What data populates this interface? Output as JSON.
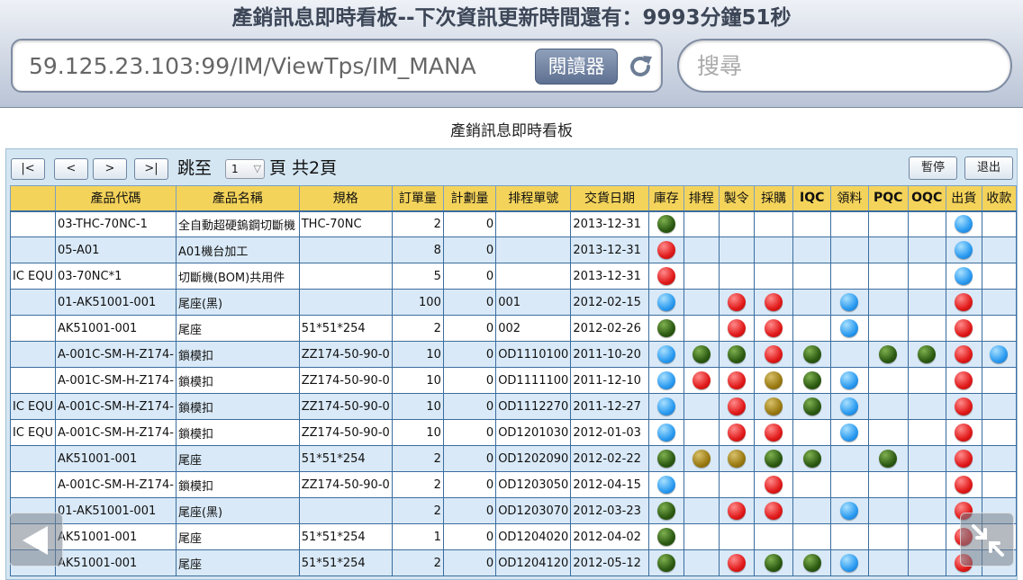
{
  "browser": {
    "title": "產銷訊息即時看板--下次資訊更新時間還有：9993分鐘51秒",
    "url": "59.125.23.103:99/IM/ViewTps/IM_MANA",
    "reader_label": "閱讀器",
    "search_placeholder": "搜尋"
  },
  "page": {
    "title": "產銷訊息即時看板",
    "nav": {
      "first": "|<",
      "prev": "<",
      "next": ">",
      "last": ">|"
    },
    "jump_label": "跳至",
    "page_value": "1",
    "page_total": "頁 共2頁",
    "pause_label": "暫停",
    "exit_label": "退出"
  },
  "table": {
    "columns": [
      "",
      "產品代碼",
      "產品名稱",
      "規格",
      "訂單量",
      "計劃量",
      "排程單號",
      "交貨日期",
      "庫存",
      "排程",
      "製令",
      "採購",
      "IQC",
      "領料",
      "PQC",
      "OQC",
      "出貨",
      "收款"
    ],
    "status_legend": {
      "G": "#2c5a12",
      "R": "#e11a1a",
      "B": "#2b9bf0",
      "Y": "#9a7a12"
    },
    "rows": [
      {
        "c0": "",
        "code": "03-THC-70NC-1",
        "name": "全自動超硬鎢鋼切斷機",
        "spec": "THC-70NC",
        "order": "2",
        "plan": "0",
        "sched": "",
        "date": "2013-12-31",
        "status": [
          "G",
          "",
          "",
          "",
          "",
          "",
          "",
          "",
          "B",
          ""
        ]
      },
      {
        "c0": "",
        "code": "05-A01",
        "name": "A01機台加工",
        "spec": "",
        "order": "8",
        "plan": "0",
        "sched": "",
        "date": "2013-12-31",
        "status": [
          "R",
          "",
          "",
          "",
          "",
          "",
          "",
          "",
          "B",
          ""
        ]
      },
      {
        "c0": "IC EQU",
        "code": "03-70NC*1",
        "name": "切斷機(BOM)共用件",
        "spec": "",
        "order": "5",
        "plan": "0",
        "sched": "",
        "date": "2013-12-31",
        "status": [
          "R",
          "",
          "",
          "",
          "",
          "",
          "",
          "",
          "B",
          ""
        ]
      },
      {
        "c0": "",
        "code": "01-AK51001-001",
        "name": "尾座(黑)",
        "spec": "",
        "order": "100",
        "plan": "0",
        "sched": "001",
        "date": "2012-02-15",
        "status": [
          "B",
          "",
          "R",
          "R",
          "",
          "B",
          "",
          "",
          "R",
          ""
        ]
      },
      {
        "c0": "",
        "code": "AK51001-001",
        "name": "尾座",
        "spec": "51*51*254",
        "order": "2",
        "plan": "0",
        "sched": "002",
        "date": "2012-02-26",
        "status": [
          "G",
          "",
          "R",
          "R",
          "",
          "B",
          "",
          "",
          "R",
          ""
        ]
      },
      {
        "c0": "",
        "code": "A-001C-SM-H-Z174-",
        "name": "鎖模扣",
        "spec": "ZZ174-50-90-0",
        "order": "10",
        "plan": "0",
        "sched": "OD1110100",
        "date": "2011-10-20",
        "status": [
          "B",
          "G",
          "G",
          "R",
          "G",
          "",
          "G",
          "G",
          "R",
          "B"
        ]
      },
      {
        "c0": "",
        "code": "A-001C-SM-H-Z174-",
        "name": "鎖模扣",
        "spec": "ZZ174-50-90-0",
        "order": "10",
        "plan": "0",
        "sched": "OD1111100",
        "date": "2011-12-10",
        "status": [
          "B",
          "R",
          "R",
          "Y",
          "G",
          "B",
          "",
          "",
          "R",
          ""
        ]
      },
      {
        "c0": "IC EQU",
        "code": "A-001C-SM-H-Z174-",
        "name": "鎖模扣",
        "spec": "ZZ174-50-90-0",
        "order": "10",
        "plan": "0",
        "sched": "OD1112270",
        "date": "2011-12-27",
        "status": [
          "B",
          "",
          "R",
          "Y",
          "G",
          "B",
          "",
          "",
          "R",
          ""
        ]
      },
      {
        "c0": "IC EQU",
        "code": "A-001C-SM-H-Z174-",
        "name": "鎖模扣",
        "spec": "ZZ174-50-90-0",
        "order": "10",
        "plan": "0",
        "sched": "OD1201030",
        "date": "2012-01-03",
        "status": [
          "B",
          "",
          "R",
          "R",
          "",
          "B",
          "",
          "",
          "R",
          ""
        ]
      },
      {
        "c0": "",
        "code": "AK51001-001",
        "name": "尾座",
        "spec": "51*51*254",
        "order": "2",
        "plan": "0",
        "sched": "OD1202090",
        "date": "2012-02-22",
        "status": [
          "G",
          "Y",
          "Y",
          "G",
          "G",
          "",
          "G",
          "",
          "R",
          ""
        ]
      },
      {
        "c0": "",
        "code": "A-001C-SM-H-Z174-",
        "name": "鎖模扣",
        "spec": "ZZ174-50-90-0",
        "order": "2",
        "plan": "0",
        "sched": "OD1203050",
        "date": "2012-04-15",
        "status": [
          "B",
          "",
          "",
          "R",
          "",
          "",
          "",
          "",
          "R",
          ""
        ]
      },
      {
        "c0": "",
        "code": "01-AK51001-001",
        "name": "尾座(黑)",
        "spec": "",
        "order": "2",
        "plan": "0",
        "sched": "OD1203070",
        "date": "2012-03-23",
        "status": [
          "G",
          "",
          "R",
          "R",
          "",
          "B",
          "",
          "",
          "R",
          ""
        ]
      },
      {
        "c0": "",
        "code": "AK51001-001",
        "name": "尾座",
        "spec": "51*51*254",
        "order": "1",
        "plan": "0",
        "sched": "OD1204020",
        "date": "2012-04-02",
        "status": [
          "G",
          "",
          "",
          "",
          "",
          "",
          "",
          "",
          "R",
          ""
        ]
      },
      {
        "c0": "",
        "code": "AK51001-001",
        "name": "尾座",
        "spec": "51*51*254",
        "order": "2",
        "plan": "0",
        "sched": "OD1204120",
        "date": "2012-05-12",
        "status": [
          "G",
          "",
          "R",
          "G",
          "G",
          "B",
          "",
          "",
          "R",
          ""
        ]
      }
    ]
  }
}
